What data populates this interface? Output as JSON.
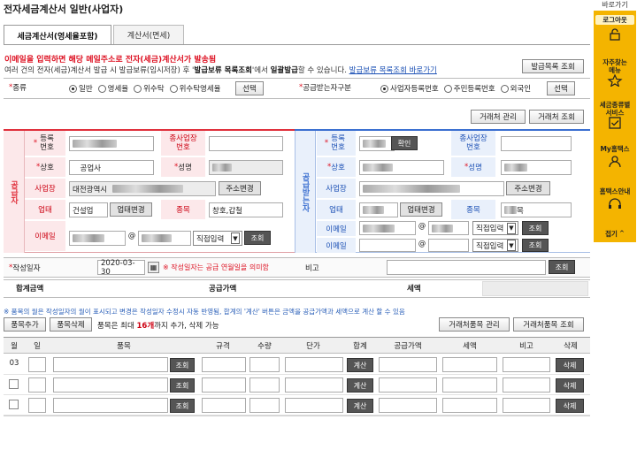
{
  "title": "전자세금계산서 일반(사업자)",
  "tabs": [
    {
      "label": "세금계산서(영세율포함)"
    },
    {
      "label": "계산서(면세)"
    }
  ],
  "warning": "이메일을 입력하면 해당 메일주소로 전자(세금)계산서가 발송됨",
  "note": {
    "part1": "여러 건의 전자(세금)계산서 발급 시 발급보류(임시저장) 후 '",
    "bold": "발급보류 목록조회",
    "part2": "'에서 ",
    "bold2": "일괄발급",
    "part3": "할 수 있습니다.",
    "link": "발급보류 목록조회 바로가기"
  },
  "buttons": {
    "issue_list": "발급목록 조회",
    "select": "선택",
    "partner_manage": "거래처 관리",
    "partner_query": "거래처 조회",
    "confirm": "확인",
    "address_change": "주소변경",
    "business_change": "업태변경",
    "query": "조회",
    "item_add": "품목추가",
    "item_delete": "품목삭제",
    "partner_item_manage": "거래처품목 관리",
    "partner_item_query": "거래처품목 조회",
    "calc": "계산",
    "delete": "삭제"
  },
  "type_row": {
    "label": "종류",
    "options": [
      "일반",
      "영세율",
      "위수탁",
      "위수탁영세율"
    ],
    "selected": "일반",
    "receiver_label": "공급받는자구분",
    "receiver_options": [
      "사업자등록번호",
      "주민등록번호",
      "외국인"
    ],
    "receiver_selected": "사업자등록번호"
  },
  "supplier": {
    "side_label": "공급자",
    "reg_no_label": "등록번호",
    "branch_label": "종사업장번호",
    "name_label": "상호",
    "name_value": "　공업사",
    "ceo_label": "성명",
    "address_label": "사업장",
    "address_value": "대전광역시",
    "biztype_label": "업태",
    "biztype_value": "건설업",
    "item_label": "종목",
    "item_value": "창호,갑철",
    "email_label": "이메일",
    "email_at": "@",
    "email_select": "직접입력"
  },
  "receiver": {
    "side_label": "공급받는자",
    "reg_no_label": "등록번호",
    "branch_label": "종사업장번호",
    "name_label": "상호",
    "ceo_label": "성명",
    "address_label": "사업장",
    "biztype_label": "업태",
    "item_label": "종목",
    "item_value": "목",
    "email_label": "이메일",
    "email2_label": "이메일",
    "email_at": "@",
    "email_select": "직접입력"
  },
  "date_row": {
    "label": "작성일자",
    "value": "2020-03-30",
    "hint": "※ 작성일자는 공급 연월일을 의미함",
    "remark_label": "비고"
  },
  "totals_row": {
    "total_label": "합계금액",
    "supply_label": "공급가액",
    "tax_label": "세액"
  },
  "item_note": "※ 품목의 월은 작성일자의 월이 표시되고 변경은 작성일자 수정시 자동 반영됨, 합계의 '계산' 버튼은 금액을 공급가액과 세액으로 계산 할 수 있음",
  "item_limit": {
    "prefix": "품목은 최대 ",
    "count": "16개",
    "suffix": "까지 추가, 삭제 가능"
  },
  "item_table": {
    "headers": [
      "월",
      "일",
      "품목",
      "규격",
      "수량",
      "단가",
      "합계",
      "공급가액",
      "세액",
      "비고",
      "삭제"
    ],
    "rows": [
      {
        "month": "03"
      },
      {
        "month": ""
      },
      {
        "month": ""
      }
    ]
  },
  "sidebar": {
    "header": "바로가기",
    "items": [
      {
        "label": "로그아웃"
      },
      {
        "label": "자주찾는\n메뉴"
      },
      {
        "label": "세금종류별\n서비스"
      },
      {
        "label": "My홈택스"
      },
      {
        "label": "홈택스안내"
      },
      {
        "label": "접기"
      }
    ]
  },
  "colors": {
    "accent_yellow": "#f4b400",
    "supplier_red": "#e0303c",
    "receiver_blue": "#3b6fd0",
    "warn_red": "#d11122"
  }
}
